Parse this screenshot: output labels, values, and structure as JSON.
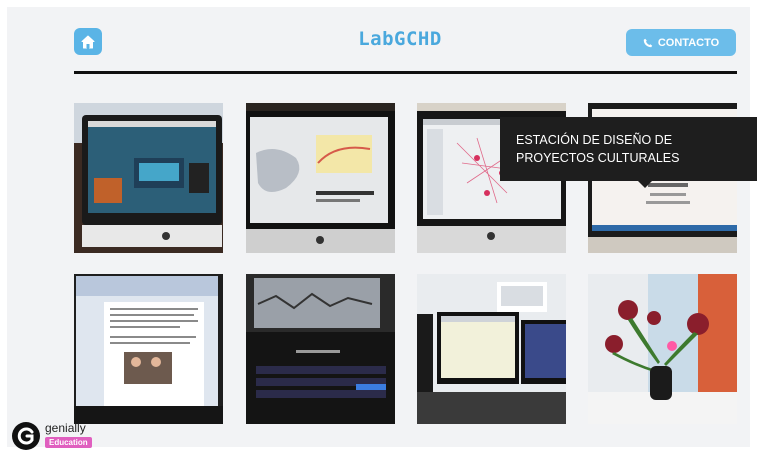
{
  "header": {
    "title": "LabGCHD",
    "contact_label": "CONTACTO",
    "home_icon": "home-icon",
    "phone_icon": "phone-icon"
  },
  "colors": {
    "accent": "#5ab4e6",
    "title": "#4aa8dd",
    "canvas": "#f2f3f5",
    "tooltip_bg": "#1e1e1e",
    "badge": "#e05fbf"
  },
  "gallery": {
    "tiles": [
      {
        "subject": "desktop-studio-monitor"
      },
      {
        "subject": "map-on-monitor"
      },
      {
        "subject": "network-graph-monitor"
      },
      {
        "subject": "document-monitor"
      },
      {
        "subject": "word-processor-screen"
      },
      {
        "subject": "alienware-laptop"
      },
      {
        "subject": "dual-monitors"
      },
      {
        "subject": "flower-vase"
      }
    ]
  },
  "tooltip": {
    "text": "ESTACIÓN DE DISEÑO DE PROYECTOS CULTURALES"
  },
  "footer": {
    "brand": "genially",
    "badge": "Education"
  }
}
